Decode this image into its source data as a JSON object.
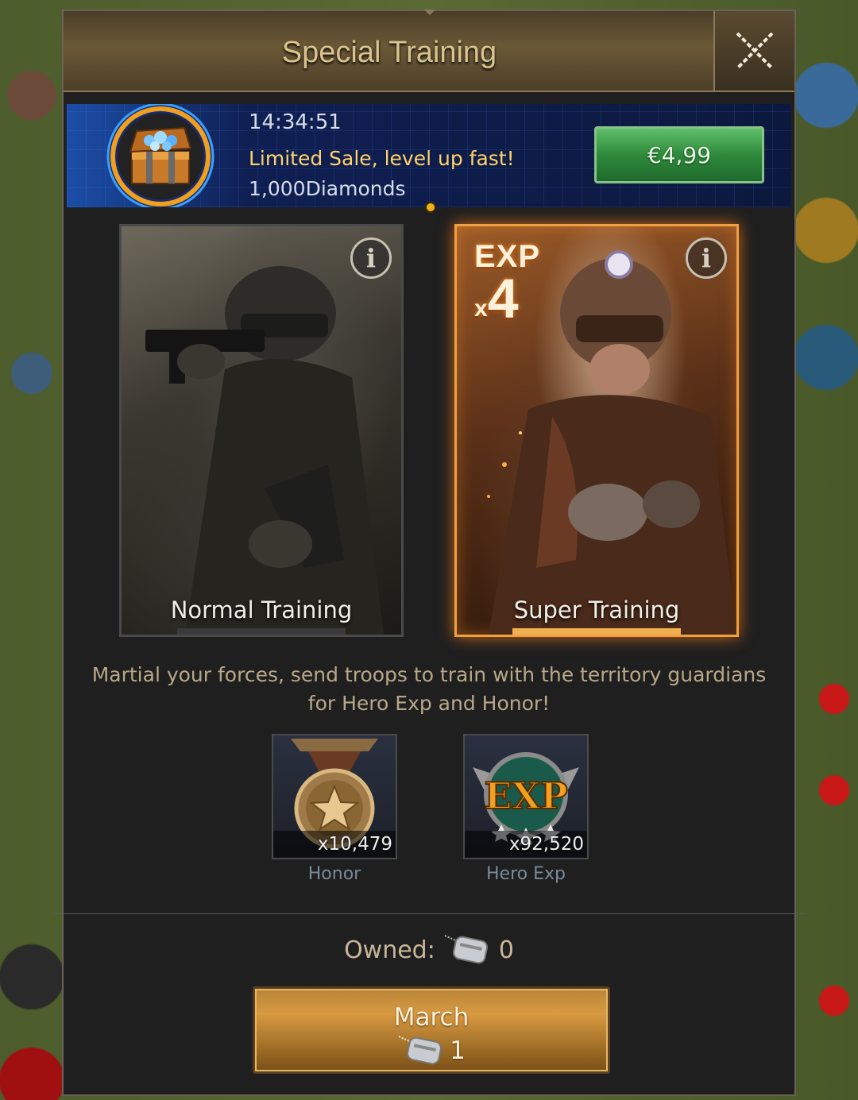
{
  "header": {
    "title": "Special Training"
  },
  "sale": {
    "timer": "14:34:51",
    "tagline": "Limited Sale, level up fast!",
    "diamonds": "1,000Diamonds",
    "price": "€4,99"
  },
  "cards": {
    "normal": {
      "label": "Normal Training",
      "info": "i"
    },
    "super": {
      "label": "Super Training",
      "info": "i",
      "exp_word": "EXP",
      "mult_x": "x",
      "mult_n": "4"
    }
  },
  "description": "Martial your forces, send troops to train with the territory guardians for Hero Exp and Honor!",
  "rewards": [
    {
      "icon": "honor-medal-icon",
      "count": "x10,479",
      "label": "Honor"
    },
    {
      "icon": "hero-exp-icon",
      "count": "x92,520",
      "label": "Hero Exp",
      "badge": "EXP"
    }
  ],
  "owned": {
    "label": "Owned:",
    "value": "0",
    "icon": "train-dog-tag-icon"
  },
  "march": {
    "label": "March",
    "cost": "1",
    "icon": "train-dog-tag-icon"
  },
  "colors": {
    "accent_gold": "#d9c48e",
    "buy_green": "#2e8a3c",
    "super_orange": "#f0a040"
  }
}
